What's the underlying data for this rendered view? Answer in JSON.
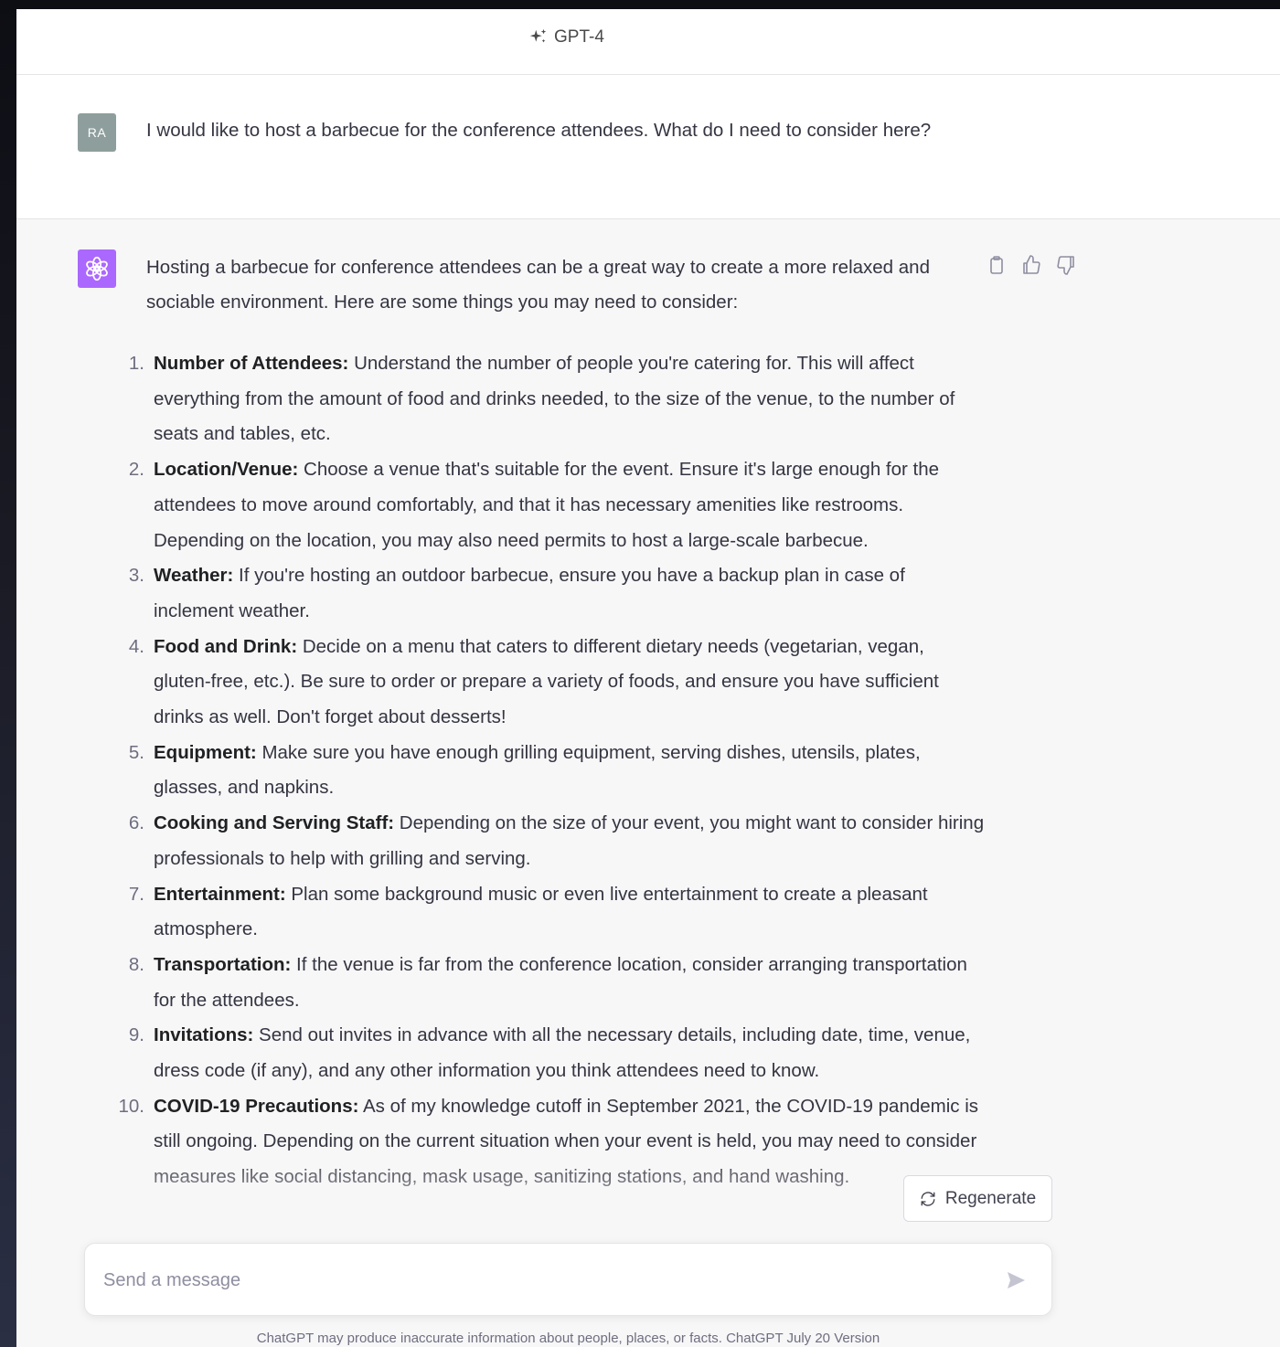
{
  "header": {
    "model_label": "GPT-4"
  },
  "user_message": {
    "avatar_initials": "RA",
    "text": "I would like to host a barbecue for the conference attendees. What do I need to consider here?"
  },
  "assistant_message": {
    "intro": "Hosting a barbecue for conference attendees can be a great way to create a more relaxed and sociable environment. Here are some things you may need to consider:",
    "items": [
      {
        "num": "1.",
        "title": "Number of Attendees:",
        "text": " Understand the number of people you're catering for. This will affect everything from the amount of food and drinks needed, to the size of the venue, to the number of seats and tables, etc."
      },
      {
        "num": "2.",
        "title": "Location/Venue:",
        "text": " Choose a venue that's suitable for the event. Ensure it's large enough for the attendees to move around comfortably, and that it has necessary amenities like restrooms. Depending on the location, you may also need permits to host a large-scale barbecue."
      },
      {
        "num": "3.",
        "title": "Weather:",
        "text": " If you're hosting an outdoor barbecue, ensure you have a backup plan in case of inclement weather."
      },
      {
        "num": "4.",
        "title": "Food and Drink:",
        "text": " Decide on a menu that caters to different dietary needs (vegetarian, vegan, gluten-free, etc.). Be sure to order or prepare a variety of foods, and ensure you have sufficient drinks as well. Don't forget about desserts!"
      },
      {
        "num": "5.",
        "title": "Equipment:",
        "text": " Make sure you have enough grilling equipment, serving dishes, utensils, plates, glasses, and napkins."
      },
      {
        "num": "6.",
        "title": "Cooking and Serving Staff:",
        "text": " Depending on the size of your event, you might want to consider hiring professionals to help with grilling and serving."
      },
      {
        "num": "7.",
        "title": "Entertainment:",
        "text": " Plan some background music or even live entertainment to create a pleasant atmosphere."
      },
      {
        "num": "8.",
        "title": "Transportation:",
        "text": " If the venue is far from the conference location, consider arranging transportation for the attendees."
      },
      {
        "num": "9.",
        "title": "Invitations:",
        "text": " Send out invites in advance with all the necessary details, including date, time, venue, dress code (if any), and any other information you think attendees need to know."
      },
      {
        "num": "10.",
        "title": "COVID-19 Precautions:",
        "text": " As of my knowledge cutoff in September 2021, the COVID-19 pandemic is still ongoing. Depending on the current situation when your event is held, you may need to consider measures like social distancing, mask usage, sanitizing stations, and hand washing."
      }
    ],
    "action_icons": [
      "copy-icon",
      "thumbs-up-icon",
      "thumbs-down-icon"
    ]
  },
  "regenerate": {
    "label": "Regenerate"
  },
  "composer": {
    "placeholder": "Send a message"
  },
  "footer": {
    "note": "ChatGPT may produce inaccurate information about people, places, or facts. ChatGPT July 20 Version"
  },
  "colors": {
    "assistant_avatar": "#ab68ff",
    "user_avatar": "#8e9e9c",
    "text": "#343541"
  }
}
